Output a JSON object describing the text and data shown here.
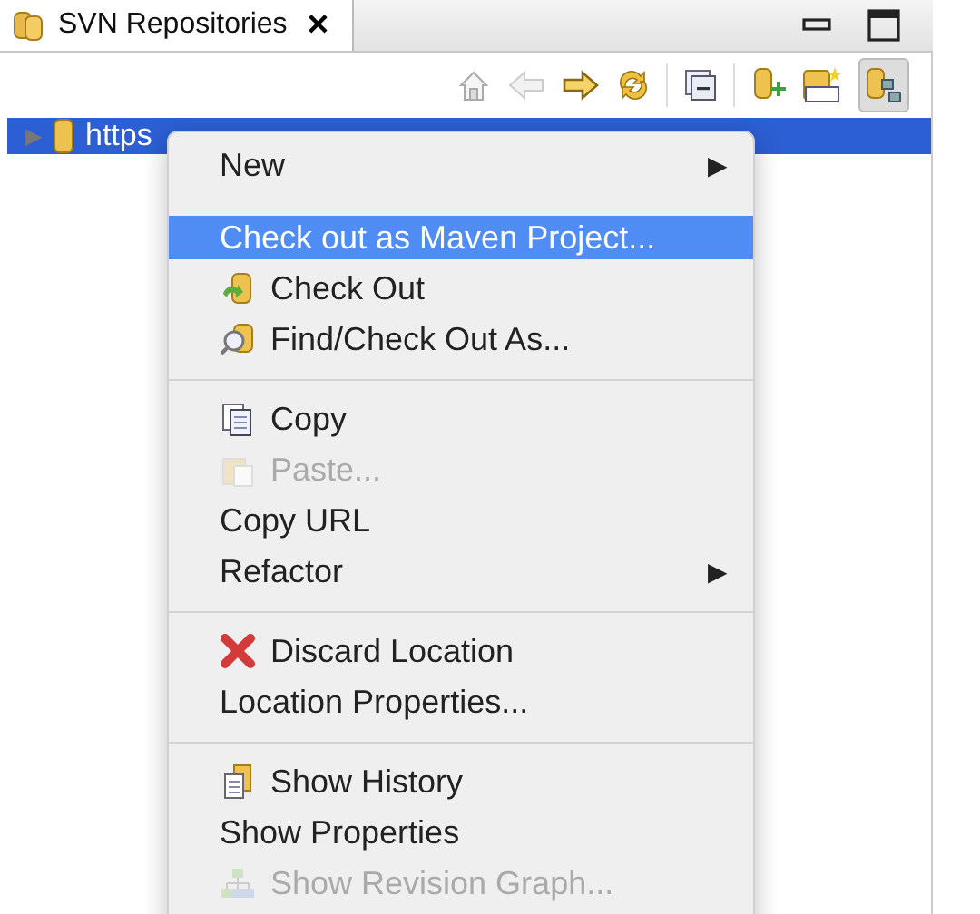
{
  "view_tab": {
    "title": "SVN Repositories",
    "close": "✕"
  },
  "tree": [
    {
      "label": "https",
      "expander": "▶",
      "selected": true
    }
  ],
  "context_menu": [
    {
      "kind": "item",
      "label": "New",
      "submenu": "▶",
      "selected": false,
      "disabled": false
    },
    {
      "kind": "item",
      "label": "Check out as Maven Project...",
      "selected": true,
      "disabled": false
    },
    {
      "kind": "item",
      "label": "Check Out",
      "selected": false,
      "disabled": false
    },
    {
      "kind": "item",
      "label": "Find/Check Out As...",
      "selected": false,
      "disabled": false
    },
    {
      "kind": "separator"
    },
    {
      "kind": "item",
      "label": "Copy",
      "selected": false,
      "disabled": false
    },
    {
      "kind": "item",
      "label": "Paste...",
      "selected": false,
      "disabled": true
    },
    {
      "kind": "item",
      "label": "Copy URL",
      "selected": false,
      "disabled": false
    },
    {
      "kind": "item",
      "label": "Refactor",
      "submenu": "▶",
      "selected": false,
      "disabled": false
    },
    {
      "kind": "separator"
    },
    {
      "kind": "item",
      "label": "Discard Location",
      "selected": false,
      "disabled": false
    },
    {
      "kind": "item",
      "label": "Location Properties...",
      "selected": false,
      "disabled": false
    },
    {
      "kind": "separator"
    },
    {
      "kind": "item",
      "label": "Show History",
      "selected": false,
      "disabled": false
    },
    {
      "kind": "item",
      "label": "Show Properties",
      "selected": false,
      "disabled": false
    },
    {
      "kind": "item",
      "label": "Show Revision Graph...",
      "selected": false,
      "disabled": true
    }
  ]
}
